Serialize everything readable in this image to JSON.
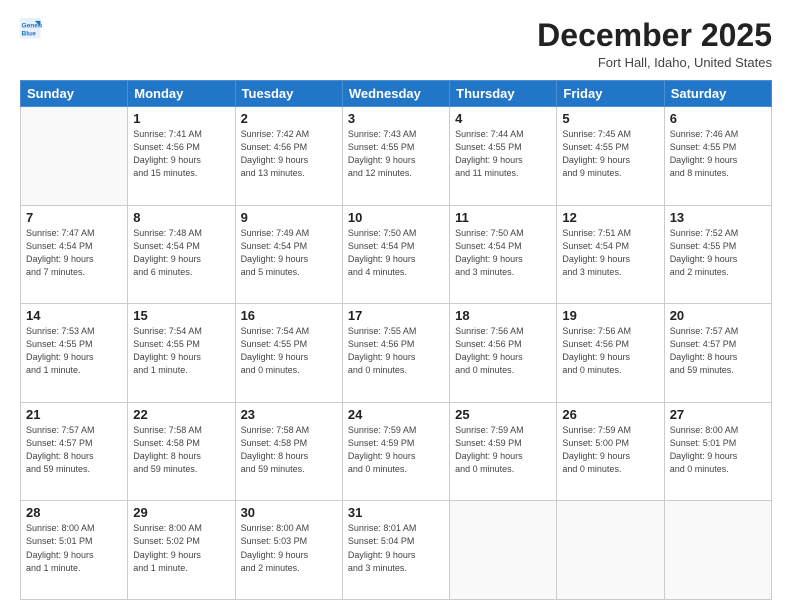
{
  "logo": {
    "line1": "General",
    "line2": "Blue"
  },
  "header": {
    "month": "December 2025",
    "location": "Fort Hall, Idaho, United States"
  },
  "weekdays": [
    "Sunday",
    "Monday",
    "Tuesday",
    "Wednesday",
    "Thursday",
    "Friday",
    "Saturday"
  ],
  "weeks": [
    [
      {
        "num": "",
        "info": ""
      },
      {
        "num": "1",
        "info": "Sunrise: 7:41 AM\nSunset: 4:56 PM\nDaylight: 9 hours\nand 15 minutes."
      },
      {
        "num": "2",
        "info": "Sunrise: 7:42 AM\nSunset: 4:56 PM\nDaylight: 9 hours\nand 13 minutes."
      },
      {
        "num": "3",
        "info": "Sunrise: 7:43 AM\nSunset: 4:55 PM\nDaylight: 9 hours\nand 12 minutes."
      },
      {
        "num": "4",
        "info": "Sunrise: 7:44 AM\nSunset: 4:55 PM\nDaylight: 9 hours\nand 11 minutes."
      },
      {
        "num": "5",
        "info": "Sunrise: 7:45 AM\nSunset: 4:55 PM\nDaylight: 9 hours\nand 9 minutes."
      },
      {
        "num": "6",
        "info": "Sunrise: 7:46 AM\nSunset: 4:55 PM\nDaylight: 9 hours\nand 8 minutes."
      }
    ],
    [
      {
        "num": "7",
        "info": "Sunrise: 7:47 AM\nSunset: 4:54 PM\nDaylight: 9 hours\nand 7 minutes."
      },
      {
        "num": "8",
        "info": "Sunrise: 7:48 AM\nSunset: 4:54 PM\nDaylight: 9 hours\nand 6 minutes."
      },
      {
        "num": "9",
        "info": "Sunrise: 7:49 AM\nSunset: 4:54 PM\nDaylight: 9 hours\nand 5 minutes."
      },
      {
        "num": "10",
        "info": "Sunrise: 7:50 AM\nSunset: 4:54 PM\nDaylight: 9 hours\nand 4 minutes."
      },
      {
        "num": "11",
        "info": "Sunrise: 7:50 AM\nSunset: 4:54 PM\nDaylight: 9 hours\nand 3 minutes."
      },
      {
        "num": "12",
        "info": "Sunrise: 7:51 AM\nSunset: 4:54 PM\nDaylight: 9 hours\nand 3 minutes."
      },
      {
        "num": "13",
        "info": "Sunrise: 7:52 AM\nSunset: 4:55 PM\nDaylight: 9 hours\nand 2 minutes."
      }
    ],
    [
      {
        "num": "14",
        "info": "Sunrise: 7:53 AM\nSunset: 4:55 PM\nDaylight: 9 hours\nand 1 minute."
      },
      {
        "num": "15",
        "info": "Sunrise: 7:54 AM\nSunset: 4:55 PM\nDaylight: 9 hours\nand 1 minute."
      },
      {
        "num": "16",
        "info": "Sunrise: 7:54 AM\nSunset: 4:55 PM\nDaylight: 9 hours\nand 0 minutes."
      },
      {
        "num": "17",
        "info": "Sunrise: 7:55 AM\nSunset: 4:56 PM\nDaylight: 9 hours\nand 0 minutes."
      },
      {
        "num": "18",
        "info": "Sunrise: 7:56 AM\nSunset: 4:56 PM\nDaylight: 9 hours\nand 0 minutes."
      },
      {
        "num": "19",
        "info": "Sunrise: 7:56 AM\nSunset: 4:56 PM\nDaylight: 9 hours\nand 0 minutes."
      },
      {
        "num": "20",
        "info": "Sunrise: 7:57 AM\nSunset: 4:57 PM\nDaylight: 8 hours\nand 59 minutes."
      }
    ],
    [
      {
        "num": "21",
        "info": "Sunrise: 7:57 AM\nSunset: 4:57 PM\nDaylight: 8 hours\nand 59 minutes."
      },
      {
        "num": "22",
        "info": "Sunrise: 7:58 AM\nSunset: 4:58 PM\nDaylight: 8 hours\nand 59 minutes."
      },
      {
        "num": "23",
        "info": "Sunrise: 7:58 AM\nSunset: 4:58 PM\nDaylight: 8 hours\nand 59 minutes."
      },
      {
        "num": "24",
        "info": "Sunrise: 7:59 AM\nSunset: 4:59 PM\nDaylight: 9 hours\nand 0 minutes."
      },
      {
        "num": "25",
        "info": "Sunrise: 7:59 AM\nSunset: 4:59 PM\nDaylight: 9 hours\nand 0 minutes."
      },
      {
        "num": "26",
        "info": "Sunrise: 7:59 AM\nSunset: 5:00 PM\nDaylight: 9 hours\nand 0 minutes."
      },
      {
        "num": "27",
        "info": "Sunrise: 8:00 AM\nSunset: 5:01 PM\nDaylight: 9 hours\nand 0 minutes."
      }
    ],
    [
      {
        "num": "28",
        "info": "Sunrise: 8:00 AM\nSunset: 5:01 PM\nDaylight: 9 hours\nand 1 minute."
      },
      {
        "num": "29",
        "info": "Sunrise: 8:00 AM\nSunset: 5:02 PM\nDaylight: 9 hours\nand 1 minute."
      },
      {
        "num": "30",
        "info": "Sunrise: 8:00 AM\nSunset: 5:03 PM\nDaylight: 9 hours\nand 2 minutes."
      },
      {
        "num": "31",
        "info": "Sunrise: 8:01 AM\nSunset: 5:04 PM\nDaylight: 9 hours\nand 3 minutes."
      },
      {
        "num": "",
        "info": ""
      },
      {
        "num": "",
        "info": ""
      },
      {
        "num": "",
        "info": ""
      }
    ]
  ]
}
